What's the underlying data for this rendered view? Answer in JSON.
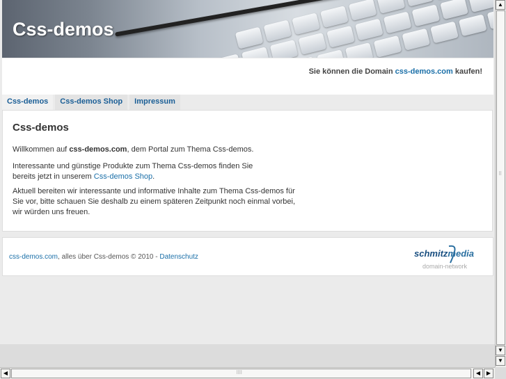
{
  "header": {
    "site_title": "Css-demos"
  },
  "domain_note": {
    "prefix": "Sie können die Domain",
    "link": "css-demos.com",
    "suffix": "kaufen!"
  },
  "tabs": [
    {
      "label": "Css-demos"
    },
    {
      "label": "Css-demos Shop"
    },
    {
      "label": "Impressum"
    }
  ],
  "content": {
    "heading": "Css-demos",
    "p1": {
      "before": "Willkommen auf",
      "bold": "css-demos.com",
      "after": ", dem Portal zum Thema Css-demos."
    },
    "p2": {
      "line1": "Interessante und günstige Produkte zum Thema Css-demos finden Sie",
      "line2_before": "bereits jetzt in unserem",
      "link": "Css-demos Shop",
      "line2_after": "."
    },
    "p3": {
      "line1": "Aktuell bereiten wir interessante und informative Inhalte zum Thema Css-demos für",
      "line2": "Sie vor, bitte schauen Sie deshalb zu einem späteren Zeitpunkt noch einmal vorbei,",
      "line3": "wir würden uns freuen."
    }
  },
  "footer": {
    "link1": "css-demos.com",
    "text": ", alles über Css-demos © 2010 -",
    "link2": "Datenschutz",
    "logo_word1": "schmitz",
    "logo_word2": "media",
    "logo_sub": "domain-network"
  },
  "scrollbars": {
    "up_icon": "arrow-up-icon",
    "down_icon": "arrow-down-icon",
    "left_icon": "arrow-left-icon",
    "right_icon": "arrow-right-icon"
  },
  "colors": {
    "link": "#1a6fa8",
    "tab_text": "#1a5e96",
    "page_bg": "#ebebeb"
  }
}
